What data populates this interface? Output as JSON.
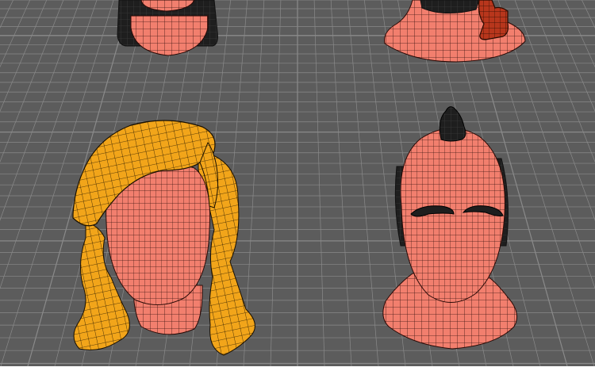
{
  "viewport": {
    "background": "#5c5c5c",
    "grid_color": "#8a8a8a",
    "grid_highlight": "#9a9a9a"
  },
  "models": [
    {
      "name": "dark-haired-head",
      "hair": "black",
      "wire_color": "#000000"
    },
    {
      "name": "red-ponytail-head",
      "hair": "dark-red",
      "wire_color": "#000000"
    },
    {
      "name": "blonde-long-hair-head",
      "hair": "orange-yellow",
      "wire_color": "#000000"
    },
    {
      "name": "bald-mohawk-head",
      "hair": "black-mohawk",
      "wire_color": "#000000"
    }
  ],
  "colors": {
    "skin": "#f27f6e",
    "skin_dark": "#d86352",
    "hair_black": "#1e1e1e",
    "hair_blonde": "#f2a51a",
    "hair_blonde_dark": "#c97f08",
    "hair_red": "#b8361c"
  }
}
